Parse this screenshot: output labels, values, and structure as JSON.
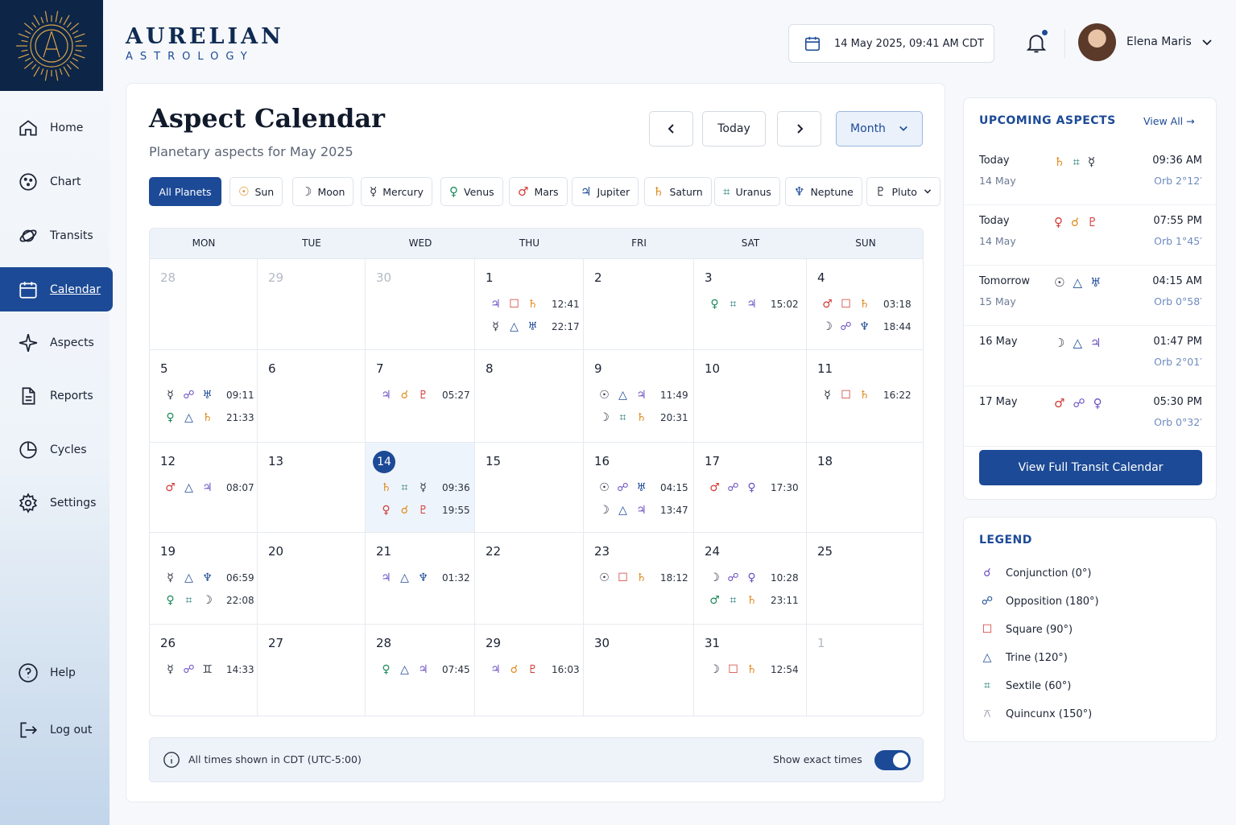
{
  "brand": {
    "name": "AURELIAN",
    "sub": "ASTROLOGY"
  },
  "header": {
    "datetime": "14 May 2025, 09:41 AM CDT",
    "user": "Elena Maris"
  },
  "nav": {
    "home": "Home",
    "chart": "Chart",
    "transits": "Transits",
    "calendar": "Calendar",
    "aspects": "Aspects",
    "reports": "Reports",
    "cycles": "Cycles",
    "settings": "Settings",
    "help": "Help",
    "logout": "Log out"
  },
  "page": {
    "title": "Aspect Calendar",
    "subtitle": "Planetary aspects for May 2025",
    "today": "Today",
    "view": "Month"
  },
  "filters": {
    "all": "All Planets",
    "sun": "Sun",
    "moon": "Moon",
    "mercury": "Mercury",
    "venus": "Venus",
    "mars": "Mars",
    "jupiter": "Jupiter",
    "saturn": "Saturn",
    "uranus": "Uranus",
    "neptune": "Neptune",
    "pluto": "Pluto"
  },
  "days": [
    "MON",
    "TUE",
    "WED",
    "THU",
    "FRI",
    "SAT",
    "SUN"
  ],
  "calendar": [
    {
      "d": "28",
      "m": true
    },
    {
      "d": "29",
      "m": true
    },
    {
      "d": "30",
      "m": true
    },
    {
      "d": "1",
      "ev": [
        {
          "s": [
            "♃",
            "☐",
            "♄"
          ],
          "c": [
            "c-purple",
            "c-red",
            "c-orange"
          ],
          "t": "12:41"
        },
        {
          "s": [
            "☿",
            "△",
            "♅"
          ],
          "c": [
            "c-dark",
            "c-blue",
            "c-blue"
          ],
          "t": "22:17"
        }
      ]
    },
    {
      "d": "2"
    },
    {
      "d": "3",
      "ev": [
        {
          "s": [
            "♀",
            "⌗",
            "♃"
          ],
          "c": [
            "c-green",
            "c-teal",
            "c-purple"
          ],
          "t": "15:02"
        }
      ]
    },
    {
      "d": "4",
      "ev": [
        {
          "s": [
            "♂",
            "☐",
            "♄"
          ],
          "c": [
            "c-red",
            "c-red",
            "c-orange"
          ],
          "t": "03:18"
        },
        {
          "s": [
            "☽",
            "☍",
            "♆"
          ],
          "c": [
            "c-dark",
            "c-purple",
            "c-blue"
          ],
          "t": "18:44"
        }
      ]
    },
    {
      "d": "5",
      "ev": [
        {
          "s": [
            "☿",
            "☍",
            "♅"
          ],
          "c": [
            "c-dark",
            "c-purple",
            "c-blue"
          ],
          "t": "09:11"
        },
        {
          "s": [
            "♀",
            "△",
            "♄"
          ],
          "c": [
            "c-green",
            "c-blue",
            "c-orange"
          ],
          "t": "21:33"
        }
      ]
    },
    {
      "d": "6"
    },
    {
      "d": "7",
      "ev": [
        {
          "s": [
            "♃",
            "☌",
            "♇"
          ],
          "c": [
            "c-purple",
            "c-orange",
            "c-red"
          ],
          "t": "05:27"
        }
      ]
    },
    {
      "d": "8"
    },
    {
      "d": "9",
      "ev": [
        {
          "s": [
            "☉",
            "△",
            "♃"
          ],
          "c": [
            "c-dark",
            "c-blue",
            "c-purple"
          ],
          "t": "11:49"
        },
        {
          "s": [
            "☽",
            "⌗",
            "♄"
          ],
          "c": [
            "c-dark",
            "c-teal",
            "c-orange"
          ],
          "t": "20:31"
        }
      ]
    },
    {
      "d": "10"
    },
    {
      "d": "11",
      "ev": [
        {
          "s": [
            "☿",
            "☐",
            "♄"
          ],
          "c": [
            "c-dark",
            "c-red",
            "c-orange"
          ],
          "t": "16:22"
        }
      ]
    },
    {
      "d": "12",
      "ev": [
        {
          "s": [
            "♂",
            "△",
            "♃"
          ],
          "c": [
            "c-red",
            "c-blue",
            "c-purple"
          ],
          "t": "08:07"
        }
      ]
    },
    {
      "d": "13"
    },
    {
      "d": "14",
      "today": true,
      "ev": [
        {
          "s": [
            "♄",
            "⌗",
            "☿"
          ],
          "c": [
            "c-orange",
            "c-teal",
            "c-dark"
          ],
          "t": "09:36"
        },
        {
          "s": [
            "♀",
            "☌",
            "♇"
          ],
          "c": [
            "c-red",
            "c-orange",
            "c-red"
          ],
          "t": "19:55"
        }
      ]
    },
    {
      "d": "15"
    },
    {
      "d": "16",
      "ev": [
        {
          "s": [
            "☉",
            "☍",
            "♅"
          ],
          "c": [
            "c-dark",
            "c-purple",
            "c-blue"
          ],
          "t": "04:15"
        },
        {
          "s": [
            "☽",
            "△",
            "♃"
          ],
          "c": [
            "c-dark",
            "c-blue",
            "c-purple"
          ],
          "t": "13:47"
        }
      ]
    },
    {
      "d": "17",
      "ev": [
        {
          "s": [
            "♂",
            "☍",
            "♀"
          ],
          "c": [
            "c-red",
            "c-purple",
            "c-purple"
          ],
          "t": "17:30"
        }
      ]
    },
    {
      "d": "18"
    },
    {
      "d": "19",
      "ev": [
        {
          "s": [
            "☿",
            "△",
            "♆"
          ],
          "c": [
            "c-dark",
            "c-blue",
            "c-blue"
          ],
          "t": "06:59"
        },
        {
          "s": [
            "♀",
            "⌗",
            "☽"
          ],
          "c": [
            "c-green",
            "c-teal",
            "c-dark"
          ],
          "t": "22:08"
        }
      ]
    },
    {
      "d": "20"
    },
    {
      "d": "21",
      "ev": [
        {
          "s": [
            "♃",
            "△",
            "♆"
          ],
          "c": [
            "c-purple",
            "c-blue",
            "c-blue"
          ],
          "t": "01:32"
        }
      ]
    },
    {
      "d": "22"
    },
    {
      "d": "23",
      "ev": [
        {
          "s": [
            "☉",
            "☐",
            "♄"
          ],
          "c": [
            "c-dark",
            "c-red",
            "c-orange"
          ],
          "t": "18:12"
        }
      ]
    },
    {
      "d": "24",
      "ev": [
        {
          "s": [
            "☽",
            "☍",
            "♀"
          ],
          "c": [
            "c-dark",
            "c-purple",
            "c-purple"
          ],
          "t": "10:28"
        },
        {
          "s": [
            "♂",
            "⌗",
            "♄"
          ],
          "c": [
            "c-green",
            "c-teal",
            "c-orange"
          ],
          "t": "23:11"
        }
      ]
    },
    {
      "d": "25"
    },
    {
      "d": "26",
      "ev": [
        {
          "s": [
            "☿",
            "☍",
            "♊"
          ],
          "c": [
            "c-dark",
            "c-purple",
            "c-dark"
          ],
          "t": "14:33"
        }
      ]
    },
    {
      "d": "27"
    },
    {
      "d": "28",
      "ev": [
        {
          "s": [
            "♀",
            "△",
            "♃"
          ],
          "c": [
            "c-green",
            "c-blue",
            "c-purple"
          ],
          "t": "07:45"
        }
      ]
    },
    {
      "d": "29",
      "ev": [
        {
          "s": [
            "♃",
            "☌",
            "♇"
          ],
          "c": [
            "c-purple",
            "c-orange",
            "c-red"
          ],
          "t": "16:03"
        }
      ]
    },
    {
      "d": "30"
    },
    {
      "d": "31",
      "ev": [
        {
          "s": [
            "☽",
            "☐",
            "♄"
          ],
          "c": [
            "c-dark",
            "c-red",
            "c-orange"
          ],
          "t": "12:54"
        }
      ]
    },
    {
      "d": "1",
      "m": true
    }
  ],
  "footer": {
    "note": "All times shown in CDT (UTC-5:00)",
    "toggle": "Show exact times"
  },
  "upcoming": {
    "title": "UPCOMING ASPECTS",
    "view_all": "View All",
    "items": [
      {
        "day": "Today",
        "date": "14 May",
        "s": [
          "♄",
          "⌗",
          "☿"
        ],
        "c": [
          "c-orange",
          "c-teal",
          "c-dark"
        ],
        "time": "09:36 AM",
        "orb": "Orb 2°12′"
      },
      {
        "day": "Today",
        "date": "14 May",
        "s": [
          "♀",
          "☌",
          "♇"
        ],
        "c": [
          "c-red",
          "c-orange",
          "c-red"
        ],
        "time": "07:55 PM",
        "orb": "Orb 1°45′"
      },
      {
        "day": "Tomorrow",
        "date": "15 May",
        "s": [
          "☉",
          "△",
          "♅"
        ],
        "c": [
          "c-dark",
          "c-blue",
          "c-blue"
        ],
        "time": "04:15 AM",
        "orb": "Orb 0°58′"
      },
      {
        "day": "16 May",
        "date": "",
        "s": [
          "☽",
          "△",
          "♃"
        ],
        "c": [
          "c-dark",
          "c-blue",
          "c-purple"
        ],
        "time": "01:47 PM",
        "orb": "Orb 2°01′"
      },
      {
        "day": "17 May",
        "date": "",
        "s": [
          "♂",
          "☍",
          "♀"
        ],
        "c": [
          "c-red",
          "c-purple",
          "c-purple"
        ],
        "time": "05:30 PM",
        "orb": "Orb 0°32′"
      }
    ],
    "button": "View Full Transit Calendar"
  },
  "legend": {
    "title": "LEGEND",
    "items": [
      {
        "s": "☌",
        "c": "c-purple",
        "label": "Conjunction (0°)"
      },
      {
        "s": "☍",
        "c": "c-blue",
        "label": "Opposition (180°)"
      },
      {
        "s": "☐",
        "c": "c-red",
        "label": "Square (90°)"
      },
      {
        "s": "△",
        "c": "c-blue",
        "label": "Trine (120°)"
      },
      {
        "s": "⌗",
        "c": "c-teal",
        "label": "Sextile (60°)"
      },
      {
        "s": "⚻",
        "c": "c-gray",
        "label": "Quincunx (150°)"
      }
    ]
  }
}
